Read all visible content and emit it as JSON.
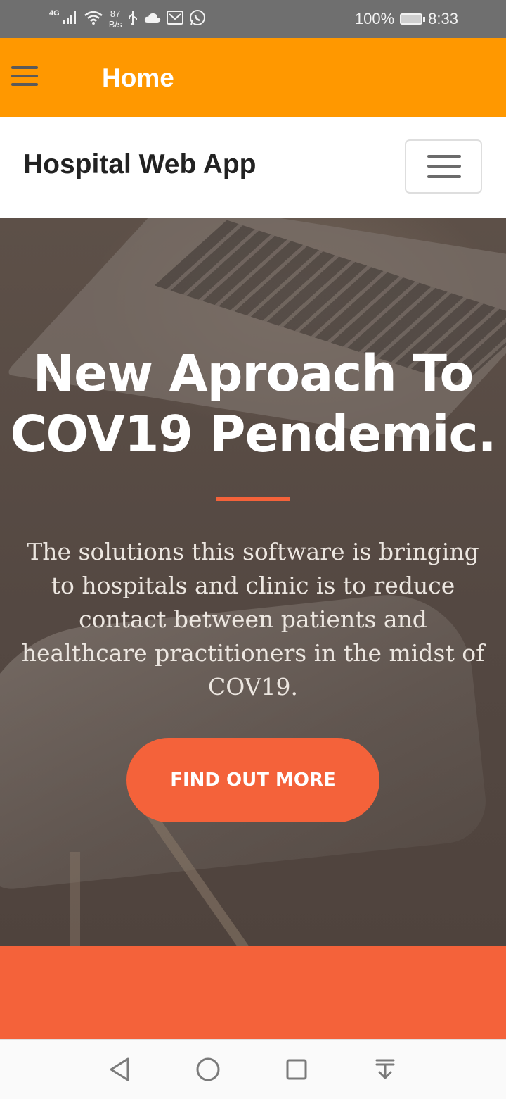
{
  "status_bar": {
    "network": "4G",
    "speed_value": "87",
    "speed_unit": "B/s",
    "battery_percent": "100%",
    "time": "8:33",
    "icons": [
      "signal-icon",
      "wifi-icon",
      "usb-icon",
      "cloud-icon",
      "mail-icon",
      "whatsapp-icon",
      "battery-icon"
    ]
  },
  "app_bar": {
    "title": "Home",
    "background": "#ff9800"
  },
  "site_nav": {
    "brand": "Hospital Web App"
  },
  "hero": {
    "title_line1": "New Aproach To",
    "title_line2": "COV19 Pendemic.",
    "body": "The solutions this software is bringing to hospitals and clinic is to reduce contact between patients and healthcare practitioners in the midst of COV19.",
    "cta_label": "FIND OUT MORE",
    "accent": "#f4623a"
  },
  "nav_bar": {
    "buttons": [
      "back-icon",
      "home-icon",
      "recents-icon",
      "notification-pull-icon"
    ]
  }
}
